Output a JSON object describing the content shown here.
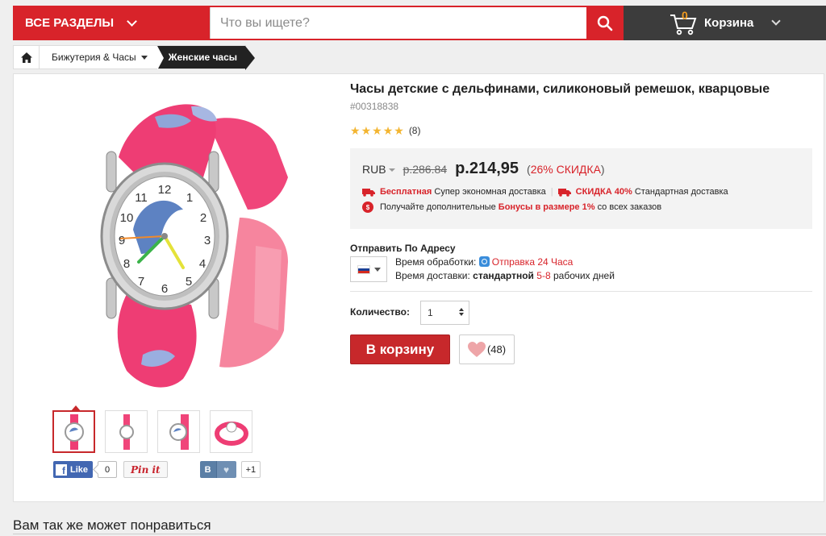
{
  "header": {
    "all_sections": "ВСЕ РАЗДЕЛЫ",
    "search_placeholder": "Что вы ищете?",
    "cart_count": "0",
    "cart_label": "Корзина"
  },
  "breadcrumb": {
    "category": "Бижутерия & Часы",
    "current": "Женские часы"
  },
  "product": {
    "title": "Часы детские с дельфинами, силиконовый ремешок, кварцовые",
    "sku": "#00318838",
    "rating_stars": 5,
    "rating_count": "(8)",
    "currency": "RUB",
    "old_price": "р.286.84",
    "new_price": "р.214,95",
    "discount_open": "(",
    "discount": "26% СКИДКА",
    "discount_close": ")",
    "free": "Бесплатная",
    "super_eco": "Супер экономная доставка",
    "discount40": "СКИДКА 40%",
    "standard": "Стандартная доставка",
    "bonus_prefix": "Получайте дополнительные",
    "bonus_red": "Бонусы в размере 1%",
    "bonus_suffix": "со всех заказов",
    "ship_to": "Отправить По Адресу",
    "processing_label": "Время обработки:",
    "processing_value": "Отправка 24 Часа",
    "delivery_label": "Время доставки:",
    "delivery_type": "стандартной",
    "delivery_days": "5-8",
    "delivery_suffix": "рабочих дней",
    "qty_label": "Количество:",
    "qty_value": "1",
    "add_to_cart": "В корзину",
    "wish_count": "(48)"
  },
  "social": {
    "fb_like": "Like",
    "fb_count": "0",
    "pinit": "Pin it",
    "vk": "В",
    "vk_plus": "+1"
  },
  "also_like": "Вам так же может понравиться",
  "colors": {
    "brand_red": "#d8232a",
    "dark": "#3c3c3c",
    "strap_pink": "#f0457a"
  }
}
